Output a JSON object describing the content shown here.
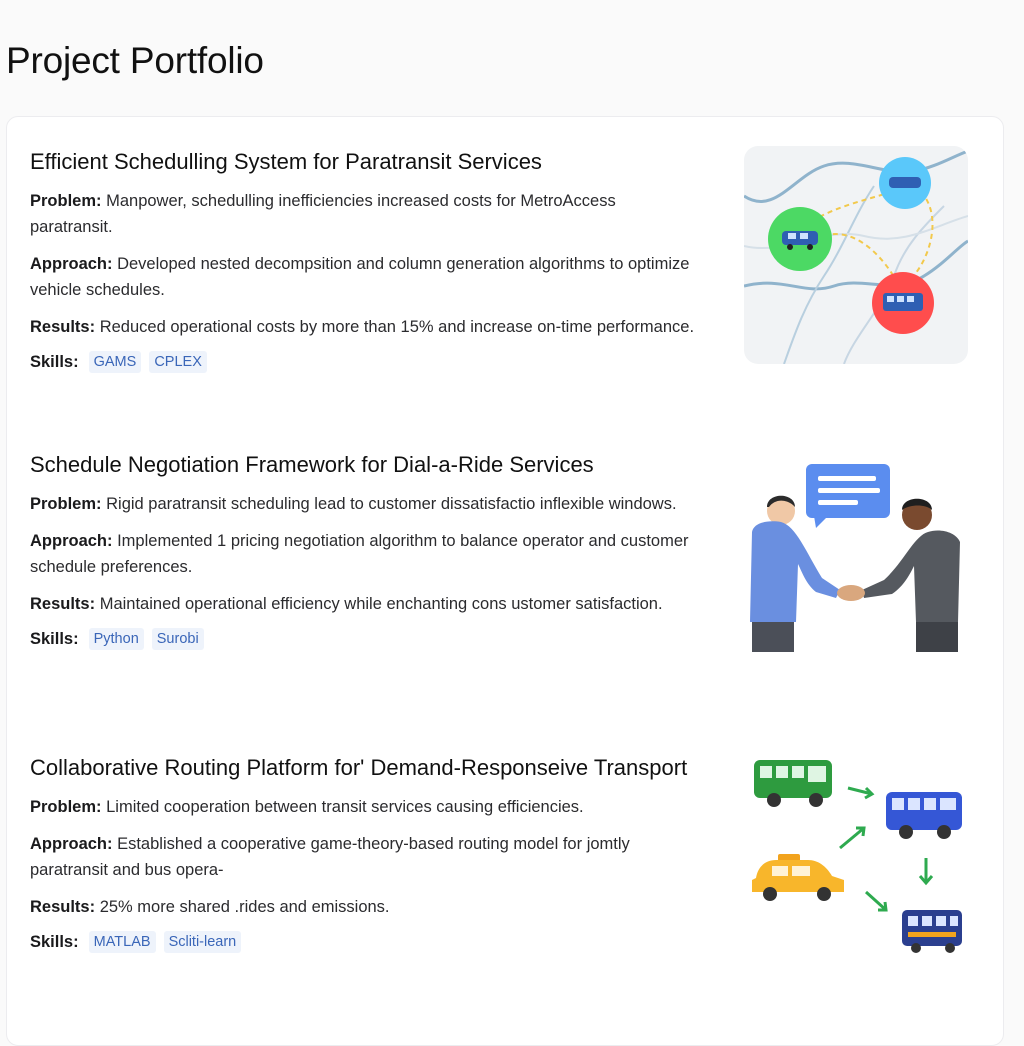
{
  "page": {
    "title": "Project Portfolio"
  },
  "projects": [
    {
      "title": "Efficient Schedulling System for Paratransit Services",
      "problem_label": "Problem:",
      "problem": "Manpower, schedulling inefficiencies increased costs for MetroAccess paratransit.",
      "approach_label": "Approach:",
      "approach": "Developed nested decompsition and column generation algorithms to optimize vehicle schedules.",
      "results_label": "Results:",
      "results": "Reduced operational costs by more than 15% and increase on-time performance.",
      "skills_label": "Skills:",
      "skills": [
        "GAMS",
        "CPLEX"
      ],
      "image": "route-map-illustration"
    },
    {
      "title": "Schedule Negotiation Framework for Dial-a-Ride Services",
      "problem_label": "Problem:",
      "problem": "Rigid paratransit scheduling lead to customer dissatisfactio inflexible windows.",
      "approach_label": "Approach:",
      "approach": "Implemented 1  pricing negotiation algorithm to balance operator and customer schedule preferences.",
      "results_label": "Results:",
      "results": "Maintained operational efficiency while enchanting cons ustomer satisfaction.",
      "skills_label": "Skills:",
      "skills": [
        "Python",
        "Surobi"
      ],
      "image": "handshake-illustration"
    },
    {
      "title": "Collaborative Routing Platform for' Demand-Responseive Transport",
      "problem_label": "Problem:",
      "problem": "Limited cooperation between transit services causing efficiencies.",
      "approach_label": "Approach:",
      "approach": "Established a cooperative game-theory-based routing model for jomtly paratransit and bus opera-",
      "results_label": "Results:",
      "results": "25% more shared .rides and emissions.",
      "skills_label": "Skills:",
      "skills": [
        "MATLAB",
        "Scliti-learn"
      ],
      "image": "vehicles-flow-illustration"
    }
  ],
  "colors": {
    "chip_bg": "#eef3fb",
    "chip_text": "#3a66b8",
    "marker_green": "#4cd964",
    "marker_blue": "#5ac8fa",
    "marker_red": "#ff4d4d"
  }
}
